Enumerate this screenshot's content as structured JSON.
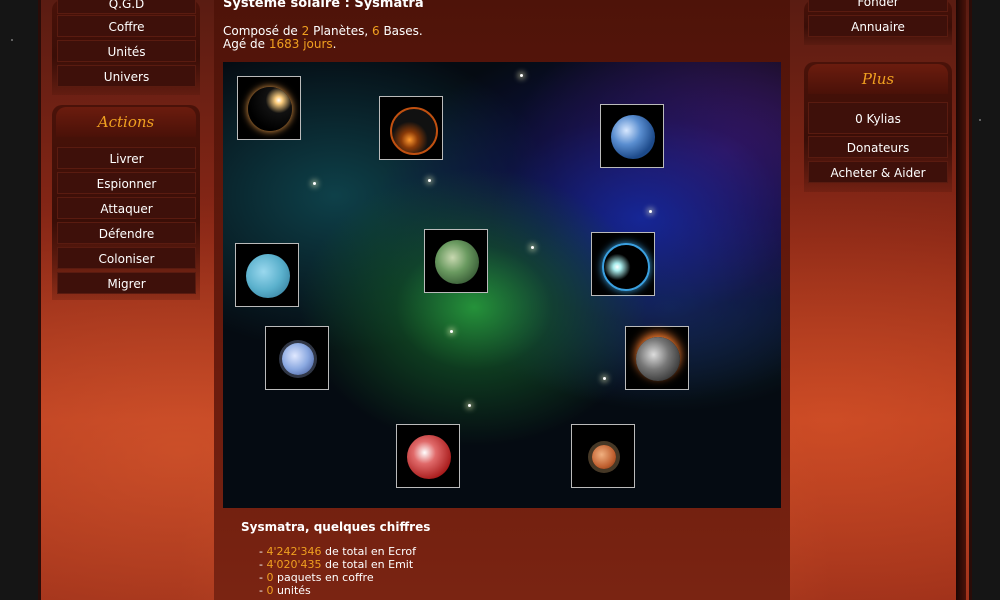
{
  "left_menu": {
    "top_items": [
      "Q.G.D",
      "Coffre",
      "Unités",
      "Univers"
    ],
    "actions_title": "Actions",
    "action_items": [
      "Livrer",
      "Espionner",
      "Attaquer",
      "Défendre",
      "Coloniser",
      "Migrer"
    ]
  },
  "right_menu": {
    "top_items": [
      "Fonder",
      "Annuaire"
    ],
    "plus_title": "Plus",
    "plus_items": [
      "0 Kylias",
      "Donateurs",
      "Acheter & Aider"
    ]
  },
  "system": {
    "title": "Système solaire : Sysmatra",
    "line1_prefix": "Composé de ",
    "planets": "2",
    "line1_mid": " Planètes, ",
    "bases": "6",
    "line1_suffix": " Bases.",
    "line2_prefix": "Agé de ",
    "age": "1683 jours",
    "line2_suffix": "."
  },
  "stats": {
    "title": "Sysmatra, quelques chiffres",
    "items": [
      {
        "value": "4'242'346",
        "label": " de total en Ecrof"
      },
      {
        "value": "4'020'435",
        "label": " de total en Emit"
      },
      {
        "value": "0",
        "label": " paquets en coffre"
      },
      {
        "value": "0",
        "label": " unités"
      }
    ]
  },
  "icons": {
    "planet_1": "eclipse-planet-icon",
    "planet_2": "dark-sun-planet-icon",
    "planet_3": "earth-planet-icon",
    "planet_4": "ice-planet-icon",
    "planet_5": "jungle-planet-icon",
    "planet_6": "moon-eclipse-icon",
    "planet_7": "ringed-blue-planet-icon",
    "planet_8": "volcanic-planet-icon",
    "planet_9": "red-planet-icon",
    "planet_10": "ringed-orange-planet-icon"
  }
}
